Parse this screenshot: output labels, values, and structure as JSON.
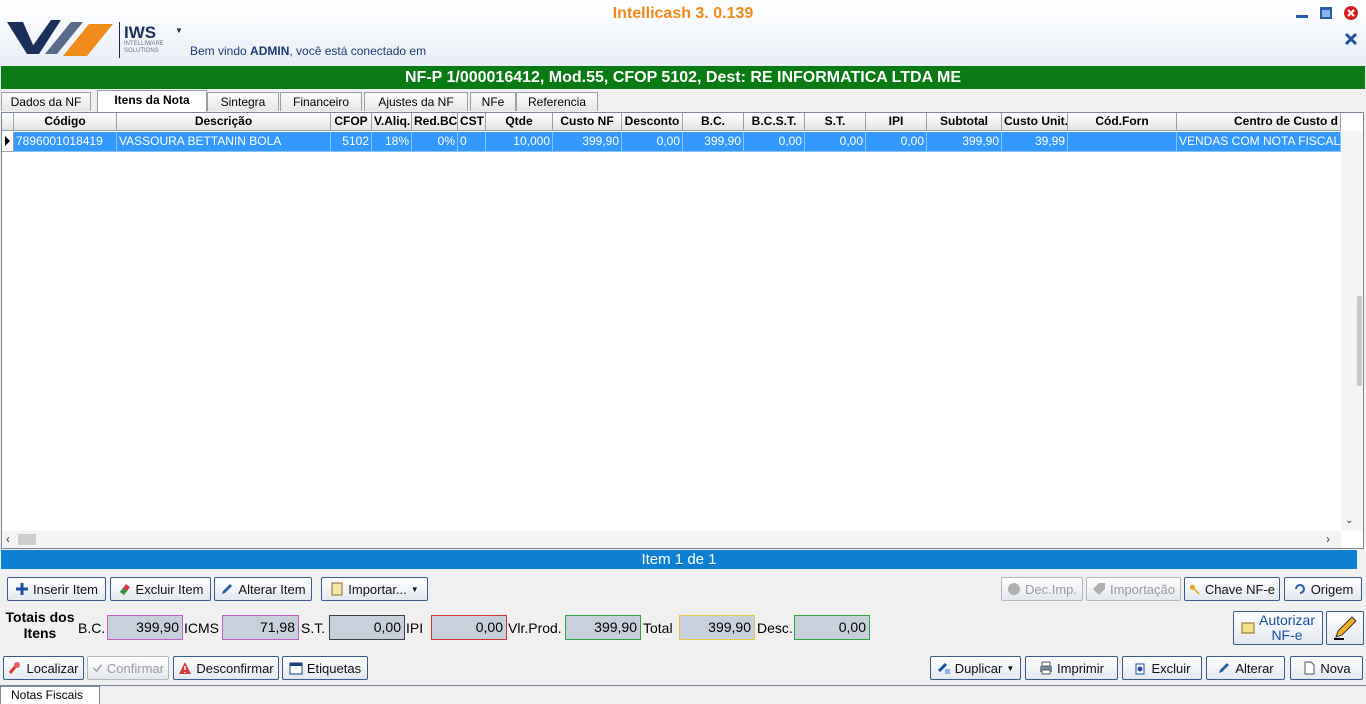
{
  "app": {
    "title": "Intellicash 3. 0.139",
    "logo_text": "IWS",
    "logo_sub": "INTELLIWARE SOLUTIONS",
    "welcome_prefix": "Bem vindo ",
    "welcome_user": "ADMIN",
    "welcome_suffix": ", você está conectado em"
  },
  "nf_title": "NF-P 1/000016412, Mod.55, CFOP 5102, Dest: RE INFORMATICA LTDA ME",
  "tabs": [
    "Dados da NF",
    "Itens da Nota",
    "Sintegra",
    "Financeiro",
    "Ajustes da NF",
    "NFe",
    "Referencia"
  ],
  "active_tab": "Itens da Nota",
  "grid": {
    "columns": [
      "Código",
      "Descrição",
      "CFOP",
      "V.Aliq.",
      "Red.BC",
      "CST",
      "Qtde",
      "Custo NF",
      "Desconto",
      "B.C.",
      "B.C.S.T.",
      "S.T.",
      "IPI",
      "Subtotal",
      "Custo Unit.",
      "Cód.Forn",
      "Centro de Custo d"
    ],
    "rows": [
      [
        "7896001018419",
        "VASSOURA BETTANIN BOLA",
        "5102",
        "18%",
        "0%",
        "0",
        "10,000",
        "399,90",
        "0,00",
        "399,90",
        "0,00",
        "0,00",
        "0,00",
        "399,90",
        "39,99",
        "",
        "VENDAS COM NOTA FISCAL"
      ]
    ]
  },
  "status": "Item 1 de 1",
  "item_buttons": {
    "insert": "Inserir Item",
    "delete": "Excluir Item",
    "edit": "Alterar Item",
    "import": "Importar...",
    "dec_imp": "Dec.Imp.",
    "importacao": "Importação",
    "chave": "Chave NF-e",
    "origem": "Origem"
  },
  "totals": {
    "heading_line1": "Totais dos",
    "heading_line2": "Itens",
    "bc_label": "B.C.",
    "bc": "399,90",
    "icms_label": "ICMS",
    "icms": "71,98",
    "st_label": "S.T.",
    "st": "0,00",
    "ipi_label": "IPI",
    "ipi": "0,00",
    "vlrprod_label": "Vlr.Prod.",
    "vlrprod": "399,90",
    "total_label": "Total",
    "total": "399,90",
    "desc_label": "Desc.",
    "desc": "0,00",
    "autorizar_line1": "Autorizar",
    "autorizar_line2": "NF-e"
  },
  "bottom_buttons": {
    "localizar": "Localizar",
    "confirmar": "Confirmar",
    "desconfirmar": "Desconfirmar",
    "etiquetas": "Etiquetas",
    "duplicar": "Duplicar",
    "imprimir": "Imprimir",
    "excluir": "Excluir",
    "alterar": "Alterar",
    "nova": "Nova"
  },
  "bottom_tab": "Notas Fiscais",
  "colors": {
    "title_green": "#0a7a14",
    "selection_blue": "#3399ff",
    "status_blue": "#0e7fd3",
    "app_title_orange": "#f08a1a"
  }
}
